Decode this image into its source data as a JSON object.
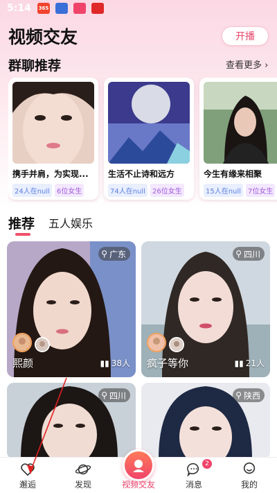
{
  "status_bar": {
    "time": "5:14",
    "icons": [
      "app-365-icon",
      "app-blue-icon",
      "app-pink-icon",
      "app-red-icon"
    ],
    "icon_labels": [
      "365",
      "",
      "",
      ""
    ]
  },
  "header": {
    "title": "视频交友",
    "broadcast_label": "开播"
  },
  "group_section": {
    "title": "群聊推荐",
    "see_more": "查看更多",
    "groups": [
      {
        "name": "携手并肩，为实现...",
        "online": "24人在null",
        "female": "6位女生"
      },
      {
        "name": "生活不止诗和远方",
        "online": "74人在null",
        "female": "26位女生"
      },
      {
        "name": "今生有缘来相聚",
        "online": "15人在null",
        "female": "7位女生"
      }
    ]
  },
  "tabs": {
    "active": "推荐",
    "other": "五人娱乐"
  },
  "feed": {
    "cards": [
      {
        "location": "广东",
        "name": "熙颜",
        "count": "38人"
      },
      {
        "location": "四川",
        "name": "疯子等你",
        "count": "21人"
      },
      {
        "location": "四川",
        "name": "",
        "count": ""
      },
      {
        "location": "陕西",
        "name": "",
        "count": ""
      }
    ]
  },
  "nav": {
    "items": [
      {
        "label": "邂逅",
        "icon": "heart-icon"
      },
      {
        "label": "发现",
        "icon": "planet-icon"
      },
      {
        "label": "视频交友",
        "icon": "video-friends-icon"
      },
      {
        "label": "消息",
        "icon": "message-icon",
        "badge": "2"
      },
      {
        "label": "我的",
        "icon": "profile-icon"
      }
    ]
  },
  "colors": {
    "accent": "#e8446a",
    "chip_blue": "#5b7fe0",
    "chip_purple": "#a05ad8",
    "header_bg": "#fbd8e4"
  }
}
